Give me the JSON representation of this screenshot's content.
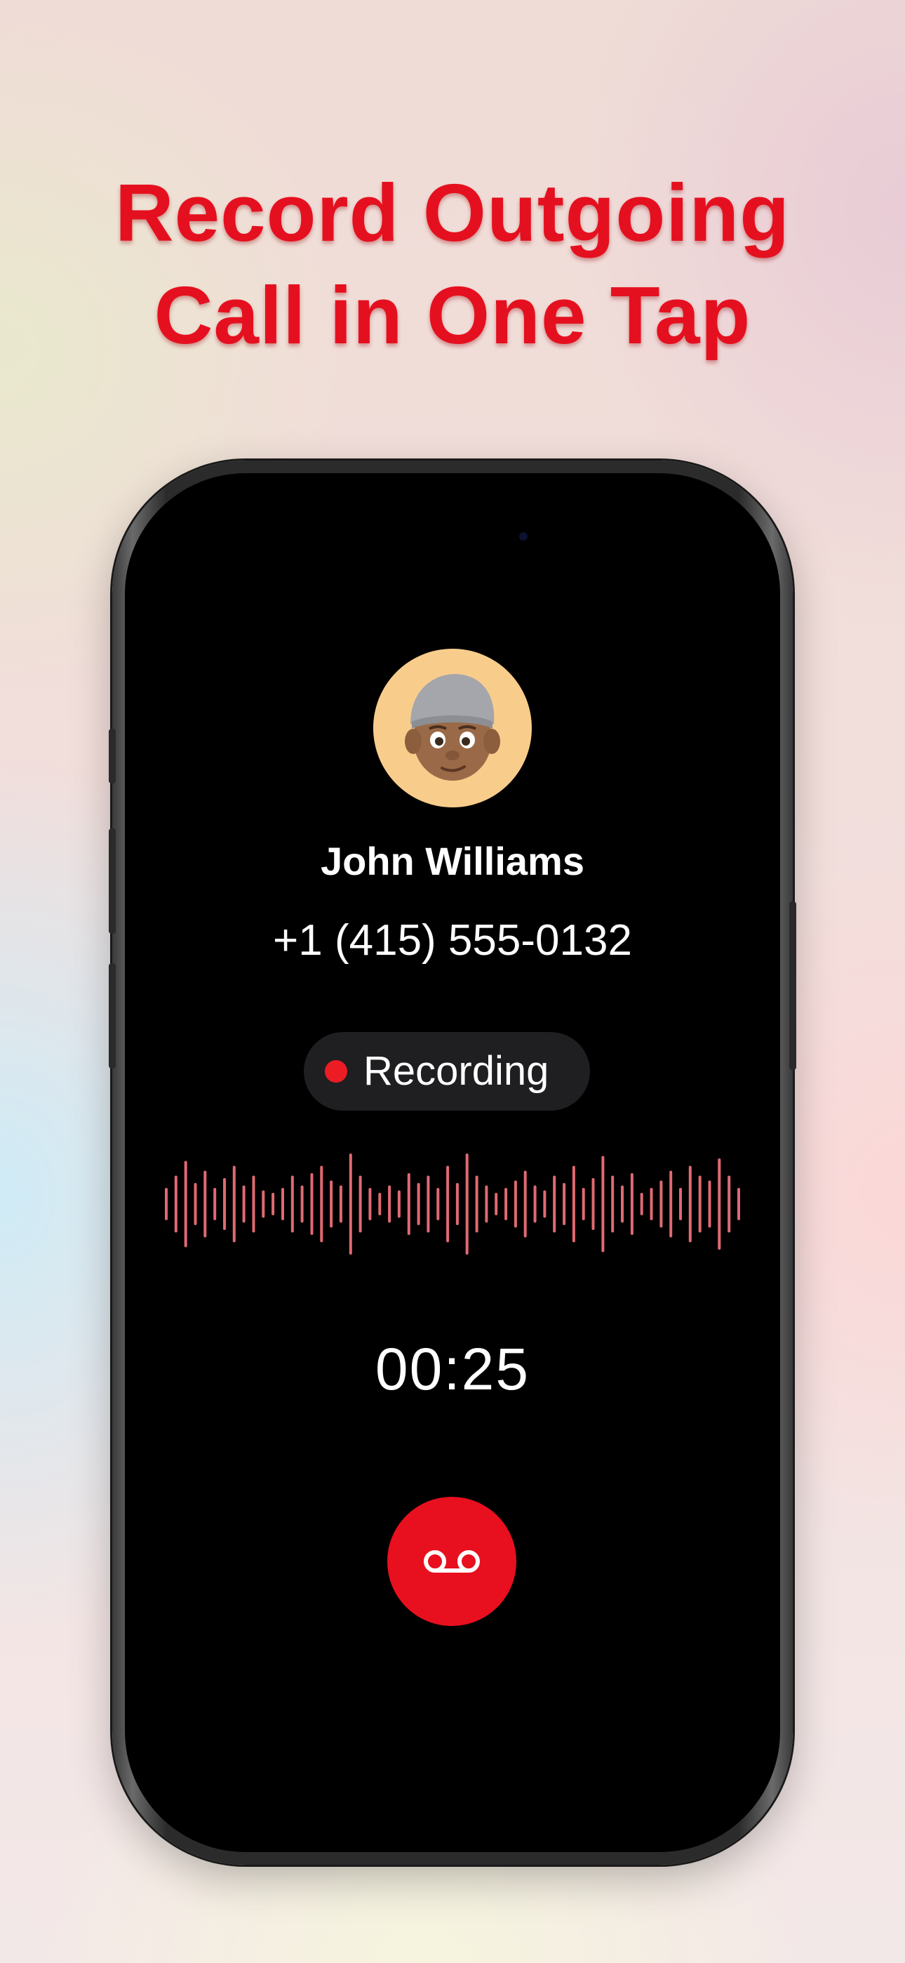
{
  "headline": {
    "line1": "Record Outgoing",
    "line2": "Call in One Tap"
  },
  "call": {
    "contact_name": "John Williams",
    "phone_number": "+1 (415) 555-0132",
    "status_label": "Recording",
    "timer": "00:25",
    "avatar_icon": "memoji-avatar-icon",
    "record_button_icon": "voicemail-icon"
  },
  "colors": {
    "accent_red": "#e5101f",
    "waveform": "#e06a72",
    "pill_bg": "#1f1f21",
    "screen_bg": "#000000"
  }
}
